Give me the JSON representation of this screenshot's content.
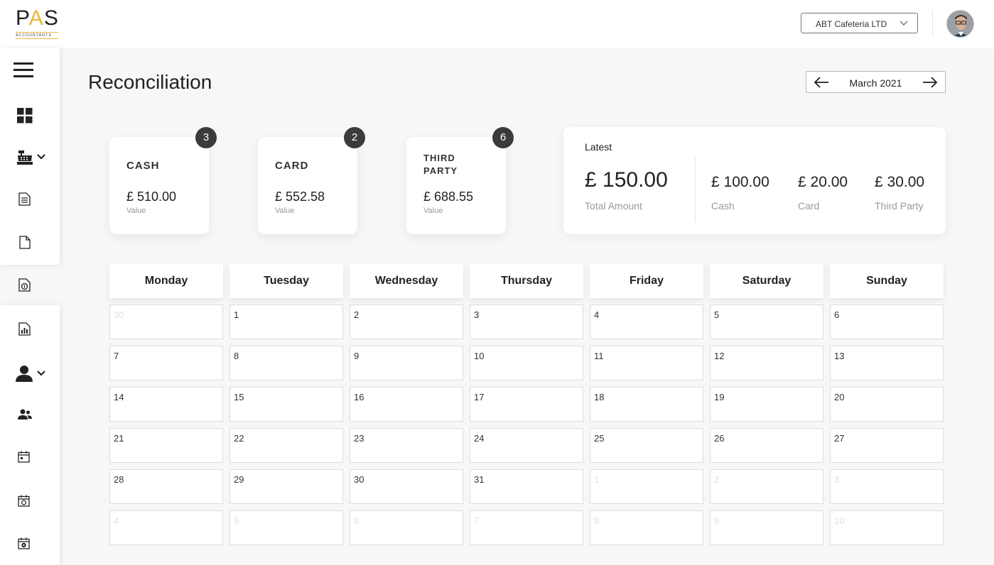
{
  "app": {
    "logo_main": "PAS",
    "logo_sub": "ACCOUNTANTS"
  },
  "header": {
    "company": "ABT Cafeteria LTD",
    "avatar": "user-avatar"
  },
  "sidebar": {
    "top_icons": [
      "hamburger-icon",
      "dashboard-icon",
      "cash-register-icon",
      "document-icon",
      "file-icon"
    ],
    "middle_icon": "money-document-icon",
    "bottom_icons": [
      "report-icon",
      "user-icon",
      "users-icon",
      "calendar-icon",
      "calendar-clock-icon",
      "calendar-settings-icon"
    ]
  },
  "page": {
    "title": "Reconciliation",
    "month": "March 2021"
  },
  "cards": [
    {
      "title": "CASH",
      "amount": "£ 510.00",
      "label": "Value",
      "badge": "3"
    },
    {
      "title": "CARD",
      "amount": "£ 552.58",
      "label": "Value",
      "badge": "2"
    },
    {
      "title": "THIRD PARTY",
      "title_l1": "THIRD",
      "title_l2": "PARTY",
      "amount": "£ 688.55",
      "label": "Value",
      "badge": "6"
    }
  ],
  "latest": {
    "title": "Latest",
    "total": "£ 150.00",
    "total_label": "Total Amount",
    "items": [
      {
        "amount": "£ 100.00",
        "label": "Cash"
      },
      {
        "amount": "£ 20.00",
        "label": "Card"
      },
      {
        "amount": "£ 30.00",
        "label": "Third Party"
      }
    ]
  },
  "calendar": {
    "days": [
      "Monday",
      "Tuesday",
      "Wednesday",
      "Thursday",
      "Friday",
      "Saturday",
      "Sunday"
    ],
    "weeks": [
      [
        "30",
        "1",
        "2",
        "3",
        "4",
        "5",
        "6"
      ],
      [
        "7",
        "8",
        "9",
        "10",
        "11",
        "12",
        "13"
      ],
      [
        "14",
        "15",
        "16",
        "17",
        "18",
        "19",
        "20"
      ],
      [
        "21",
        "22",
        "23",
        "24",
        "25",
        "26",
        "27"
      ],
      [
        "28",
        "29",
        "30",
        "31",
        "1",
        "2",
        "3"
      ],
      [
        "4",
        "5",
        "6",
        "7",
        "8",
        "9",
        "10"
      ]
    ]
  },
  "colors": {
    "badge": "#3b3b3b",
    "accent": "#e8b63a",
    "muted_text": "#999999"
  }
}
